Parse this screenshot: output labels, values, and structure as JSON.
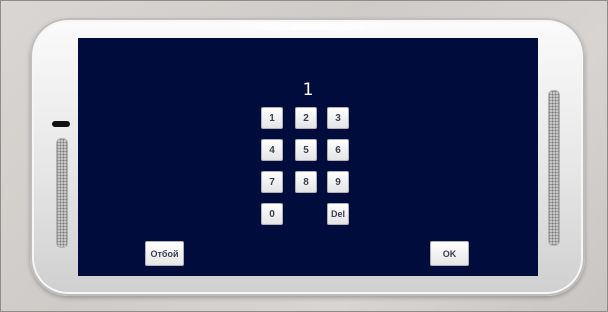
{
  "display": {
    "value": "1"
  },
  "keypad": {
    "keys": [
      {
        "label": "1",
        "name": "key-1"
      },
      {
        "label": "2",
        "name": "key-2"
      },
      {
        "label": "3",
        "name": "key-3"
      },
      {
        "label": "4",
        "name": "key-4"
      },
      {
        "label": "5",
        "name": "key-5"
      },
      {
        "label": "6",
        "name": "key-6"
      },
      {
        "label": "7",
        "name": "key-7"
      },
      {
        "label": "8",
        "name": "key-8"
      },
      {
        "label": "9",
        "name": "key-9"
      },
      {
        "label": "0",
        "name": "key-0"
      },
      {
        "label": "Del",
        "name": "key-del"
      }
    ]
  },
  "actions": {
    "hangup_label": "Отбой",
    "ok_label": "OK"
  },
  "colors": {
    "screen_background": "#000c3c",
    "key_face": "#ffffff",
    "key_text": "#3a3f52"
  }
}
